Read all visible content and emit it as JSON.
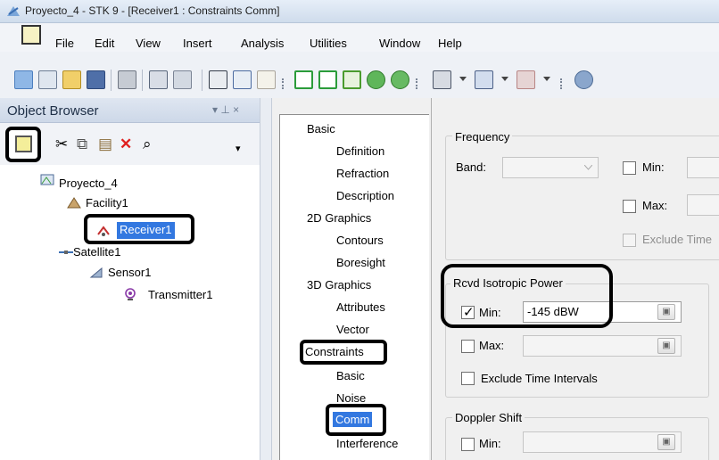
{
  "window": {
    "title": "Proyecto_4 - STK 9 - [Receiver1 : Constraints Comm]"
  },
  "menu": [
    {
      "label": "File"
    },
    {
      "label": "Edit"
    },
    {
      "label": "View"
    },
    {
      "label": "Insert"
    },
    {
      "label": "Analysis"
    },
    {
      "label": "Utilities"
    },
    {
      "label": "Window"
    },
    {
      "label": "Help"
    }
  ],
  "toolbar_icons": [
    "globe-view-icon",
    "map-view-icon",
    "open-icon",
    "save-icon",
    "print-icon",
    "insert-icon",
    "object-icon",
    "html-report-icon",
    "report-icon",
    "graph-icon",
    "access-icon",
    "chain-icon",
    "deck-icon",
    "analysis-icon",
    "settings-icon"
  ],
  "object_browser": {
    "title": "Object Browser",
    "pin": "▾ ⊥ ×",
    "tree": [
      {
        "label": "Proyecto_4",
        "icon": "scenario-icon"
      },
      {
        "label": "Facility1",
        "icon": "facility-icon"
      },
      {
        "label": "Receiver1",
        "icon": "receiver-icon",
        "selected": true
      },
      {
        "label": "Satellite1",
        "icon": "satellite-icon"
      },
      {
        "label": "Sensor1",
        "icon": "sensor-icon"
      },
      {
        "label": "Transmitter1",
        "icon": "transmitter-icon"
      }
    ]
  },
  "nav": {
    "sections": [
      {
        "label": "Basic",
        "items": [
          "Definition",
          "Refraction",
          "Description"
        ]
      },
      {
        "label": "2D Graphics",
        "items": [
          "Contours",
          "Boresight"
        ]
      },
      {
        "label": "3D Graphics",
        "items": [
          "Attributes",
          "Vector"
        ]
      },
      {
        "label": "Constraints",
        "items": [
          "Basic",
          "Noise",
          "Comm",
          "Interference"
        ]
      }
    ],
    "selected": "Comm"
  },
  "panel": {
    "frequency": {
      "title": "Frequency",
      "band_label": "Band:",
      "min_label": "Min:",
      "max_label": "Max:",
      "exclude_label": "Exclude Time"
    },
    "rip": {
      "title": "Rcvd Isotropic Power",
      "min_label": "Min:",
      "min_value": "-145 dBW",
      "min_checked": true,
      "max_label": "Max:",
      "exclude_label": "Exclude Time Intervals"
    },
    "doppler": {
      "title": "Doppler Shift",
      "min_label": "Min:"
    }
  }
}
